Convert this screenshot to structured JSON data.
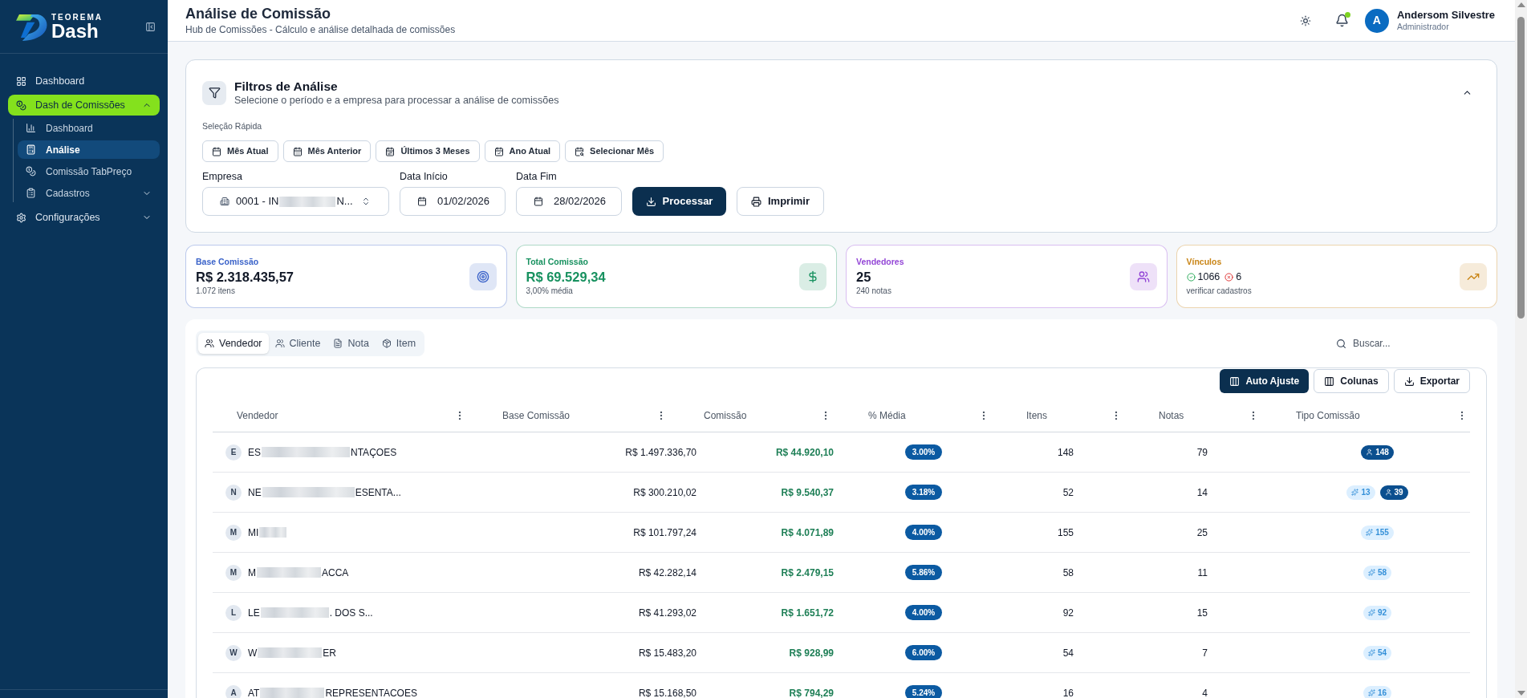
{
  "sidebar": {
    "brand": {
      "top": "TEOREMA",
      "main": "Dash"
    },
    "items": [
      {
        "label": "Dashboard",
        "selected": false
      },
      {
        "label": "Dash de Comissões",
        "selected": true,
        "expanded": true,
        "children": [
          {
            "label": "Dashboard",
            "selected": false
          },
          {
            "label": "Análise",
            "selected": true
          },
          {
            "label": "Comissão TabPreço",
            "selected": false
          },
          {
            "label": "Cadastros",
            "selected": false,
            "expanded": false
          }
        ]
      },
      {
        "label": "Configurações",
        "selected": false,
        "expanded": false
      }
    ]
  },
  "header": {
    "title": "Análise de Comissão",
    "subtitle": "Hub de Comissões - Cálculo e análise detalhada de comissões",
    "has_unread": true,
    "user": {
      "initial": "A",
      "name": "Andersom Silvestre",
      "role": "Administrador"
    }
  },
  "filters": {
    "title": "Filtros de Análise",
    "subtitle": "Selecione o período e a empresa para processar a análise de comissões",
    "expanded": true,
    "quick_label": "Seleção Rápida",
    "quick_buttons": [
      "Mês Atual",
      "Mês Anterior",
      "Últimos 3 Meses",
      "Ano Atual",
      "Selecionar Mês"
    ],
    "fields": [
      {
        "kind": "select",
        "label": "Empresa",
        "value_start": "0001 - IN",
        "value_end": "N..."
      },
      {
        "kind": "date",
        "label": "Data Início",
        "value": "01/02/2026"
      },
      {
        "kind": "date",
        "label": "Data Fim",
        "value": "28/02/2026"
      }
    ],
    "actions": [
      {
        "label": "Processar",
        "kind": "primary"
      },
      {
        "label": "Imprimir",
        "kind": "secondary"
      }
    ]
  },
  "stats": [
    {
      "kind": "amount",
      "label": "Base Comissão",
      "value": "R$ 2.318.435,57",
      "note": "1.072 itens",
      "color": "#3b63c9",
      "value_highlight": false
    },
    {
      "kind": "amount",
      "label": "Total Comissão",
      "value": "R$ 69.529,34",
      "note": "3,00% média",
      "color": "#17915f",
      "value_highlight": true
    },
    {
      "kind": "amount",
      "label": "Vendedores",
      "value": "25",
      "note": "240 notas",
      "color": "#9346d6",
      "value_highlight": false
    },
    {
      "kind": "links",
      "label": "Vínculos",
      "ok_count": "1066",
      "error_count": "6",
      "note": "verificar cadastros",
      "color": "#c98516"
    }
  ],
  "analysis": {
    "tabs": [
      {
        "label": "Vendedor",
        "selected": true
      },
      {
        "label": "Cliente",
        "selected": false
      },
      {
        "label": "Nota",
        "selected": false
      },
      {
        "label": "Item",
        "selected": false
      }
    ],
    "search": {
      "placeholder": "Buscar..."
    },
    "toolbar": [
      {
        "label": "Auto Ajuste",
        "kind": "primary"
      },
      {
        "label": "Colunas",
        "kind": "outline"
      },
      {
        "label": "Exportar",
        "kind": "outline"
      }
    ],
    "table": {
      "columns": [
        "Vendedor",
        "Base Comissão",
        "Comissão",
        "% Média",
        "Itens",
        "Notas",
        "Tipo Comissão"
      ],
      "rows": [
        {
          "initial": "E",
          "name_start": "ES",
          "name_end": "NTAÇOES",
          "base": "R$ 1.497.336,70",
          "commission": "R$ 44.920,10",
          "average": "3.00%",
          "items": "148",
          "notes": "79",
          "types": [
            {
              "kind": "person",
              "count": "148"
            }
          ]
        },
        {
          "initial": "N",
          "name_start": "NE",
          "name_end": "ESENTA...",
          "base": "R$ 300.210,02",
          "commission": "R$ 9.540,37",
          "average": "3.18%",
          "items": "52",
          "notes": "14",
          "types": [
            {
              "kind": "auto",
              "count": "13"
            },
            {
              "kind": "person",
              "count": "39"
            }
          ]
        },
        {
          "initial": "M",
          "name_start": "MI",
          "base": "R$ 101.797,24",
          "commission": "R$ 4.071,89",
          "average": "4.00%",
          "items": "155",
          "notes": "25",
          "types": [
            {
              "kind": "auto",
              "count": "155"
            }
          ]
        },
        {
          "initial": "M",
          "name_start": "M",
          "name_end": "ACCA",
          "base": "R$ 42.282,14",
          "commission": "R$ 2.479,15",
          "average": "5.86%",
          "items": "58",
          "notes": "11",
          "types": [
            {
              "kind": "auto",
              "count": "58"
            }
          ]
        },
        {
          "initial": "L",
          "name_start": "LE",
          "name_end": ". DOS S...",
          "base": "R$ 41.293,02",
          "commission": "R$ 1.651,72",
          "average": "4.00%",
          "items": "92",
          "notes": "15",
          "types": [
            {
              "kind": "auto",
              "count": "92"
            }
          ]
        },
        {
          "initial": "W",
          "name_start": "W",
          "name_end": "ER",
          "base": "R$ 15.483,20",
          "commission": "R$ 928,99",
          "average": "6.00%",
          "items": "54",
          "notes": "7",
          "types": [
            {
              "kind": "auto",
              "count": "54"
            }
          ]
        },
        {
          "initial": "A",
          "name_start": "AT",
          "name_end": "REPRESENTACOES",
          "base": "R$ 15.168,50",
          "commission": "R$ 794,29",
          "average": "5.24%",
          "items": "16",
          "notes": "4",
          "types": [
            {
              "kind": "auto",
              "count": "16"
            }
          ]
        }
      ]
    }
  }
}
